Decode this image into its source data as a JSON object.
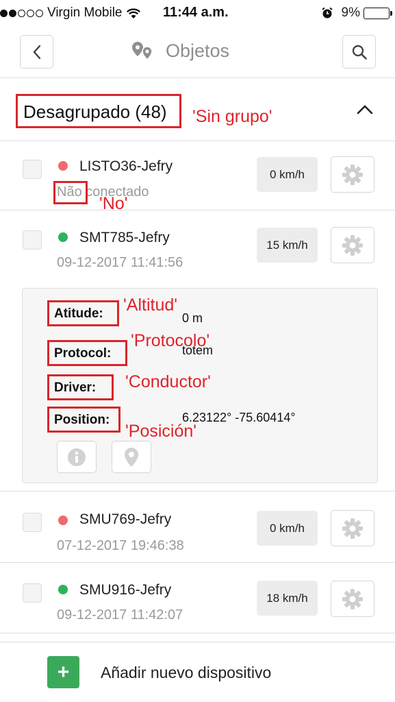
{
  "status_bar": {
    "carrier": "Virgin Mobile",
    "time": "11:44 a.m.",
    "battery": "9%",
    "signal_bars_filled": 2,
    "signal_bars_total": 5
  },
  "header": {
    "title": "Objetos",
    "back_icon": "chevron-left-icon",
    "search_icon": "search-icon",
    "logo_icon": "map-pins-icon"
  },
  "group": {
    "title": "Desagrupado (48)",
    "annotation": "'Sin grupo'",
    "collapse_icon": "chevron-up-icon"
  },
  "devices": [
    {
      "name": "LISTO36-Jefry",
      "status_color": "#f06b6b",
      "sub_prefix": "Não",
      "sub_rest": " conectado",
      "speed": "0 km/h",
      "annotation": "'No'"
    },
    {
      "name": "SMT785-Jefry",
      "status_color": "#2db35d",
      "sub": "09-12-2017 11:41:56",
      "speed": "15 km/h"
    },
    {
      "name": "SMU769-Jefry",
      "status_color": "#f06b6b",
      "sub": "07-12-2017 19:46:38",
      "speed": "0 km/h"
    },
    {
      "name": "SMU916-Jefry",
      "status_color": "#2db35d",
      "sub": "09-12-2017 11:42:07",
      "speed": "18 km/h"
    }
  ],
  "details": {
    "rows": [
      {
        "label": "Atitude:",
        "value": "0 m",
        "annotation": "'Altitud'"
      },
      {
        "label": "Protocol:",
        "value": "totem",
        "annotation": "'Protocolo'"
      },
      {
        "label": "Driver:",
        "value": "",
        "annotation": "'Conductor'"
      },
      {
        "label": "Position:",
        "value": "6.23122° -75.60414°",
        "annotation": "'Posición'"
      }
    ],
    "info_icon": "info-icon",
    "location_icon": "location-pin-icon"
  },
  "footer": {
    "add_label": "Añadir nuevo dispositivo",
    "add_symbol": "+"
  },
  "colors": {
    "annotation_red": "#d8262b",
    "online_green": "#2db35d",
    "offline_red": "#f06b6b",
    "add_green": "#3aaa5a"
  }
}
